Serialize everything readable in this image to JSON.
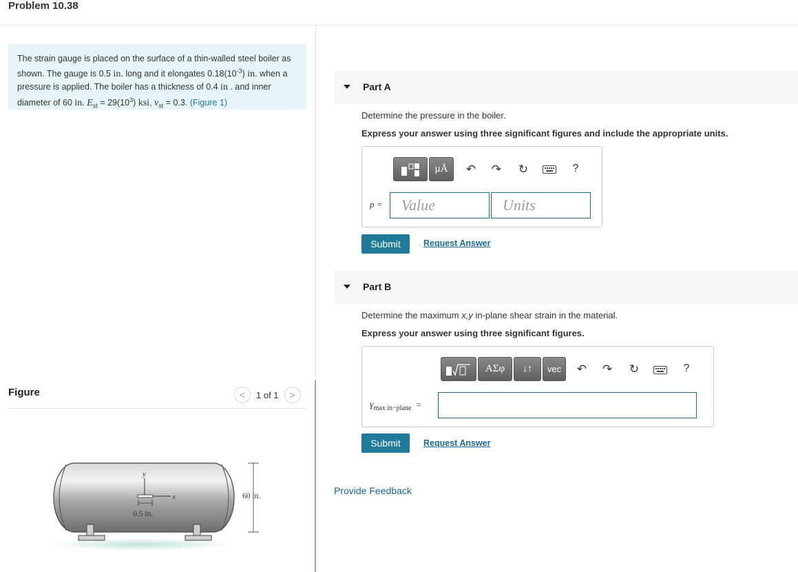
{
  "problem": {
    "title": "Problem 10.38",
    "text_parts": {
      "p1": "The strain gauge is placed on the surface of a thin-walled steel boiler as shown. The gauge is 0.5 ",
      "u1": "in.",
      "p2": " long and it elongates 0.18(10",
      "e1": "-3",
      "p3": ") ",
      "u2": "in.",
      "p4": " when a pressure is applied. The boiler has a thickness of 0.4 ",
      "u3": "in",
      "p5": " . and inner diameter of 60 ",
      "u4": "in.",
      "p6": " ",
      "E": "E",
      "st": "st",
      "p7": " = 29(10",
      "e2": "3",
      "p8": ") ",
      "ksi": "ksi",
      "p9": ", ",
      "nu": "ν",
      "st2": "st",
      "p10": " = 0.3. ",
      "fig_link": "(Figure 1)"
    }
  },
  "figure_panel": {
    "label": "Figure",
    "pager": "1 of 1",
    "prev": "<",
    "next": ">",
    "labels": {
      "y": "y",
      "x": "x",
      "gauge_len": "0.5 in.",
      "diameter": "60 in."
    }
  },
  "part_a": {
    "label": "Part A",
    "question": "Determine the pressure in the boiler.",
    "instruction": "Express your answer using three significant figures and include the appropriate units.",
    "var": "p =",
    "value_placeholder": "Value",
    "units_placeholder": "Units",
    "toolbar": {
      "units_btn": "μÅ",
      "help": "?"
    },
    "submit": "Submit",
    "request": "Request Answer"
  },
  "part_b": {
    "label": "Part B",
    "question_pre": "Determine the maximum ",
    "question_xy": "x,y",
    "question_post": " in-plane shear strain in the material.",
    "instruction": "Express your answer using three significant figures.",
    "var_main": "γ",
    "var_sub": "max in−plane",
    "var_eq": "=",
    "toolbar": {
      "greek": "ΑΣφ",
      "arrows": "↓↑",
      "vec": "vec",
      "help": "?"
    },
    "submit": "Submit",
    "request": "Request Answer"
  },
  "feedback": "Provide Feedback"
}
